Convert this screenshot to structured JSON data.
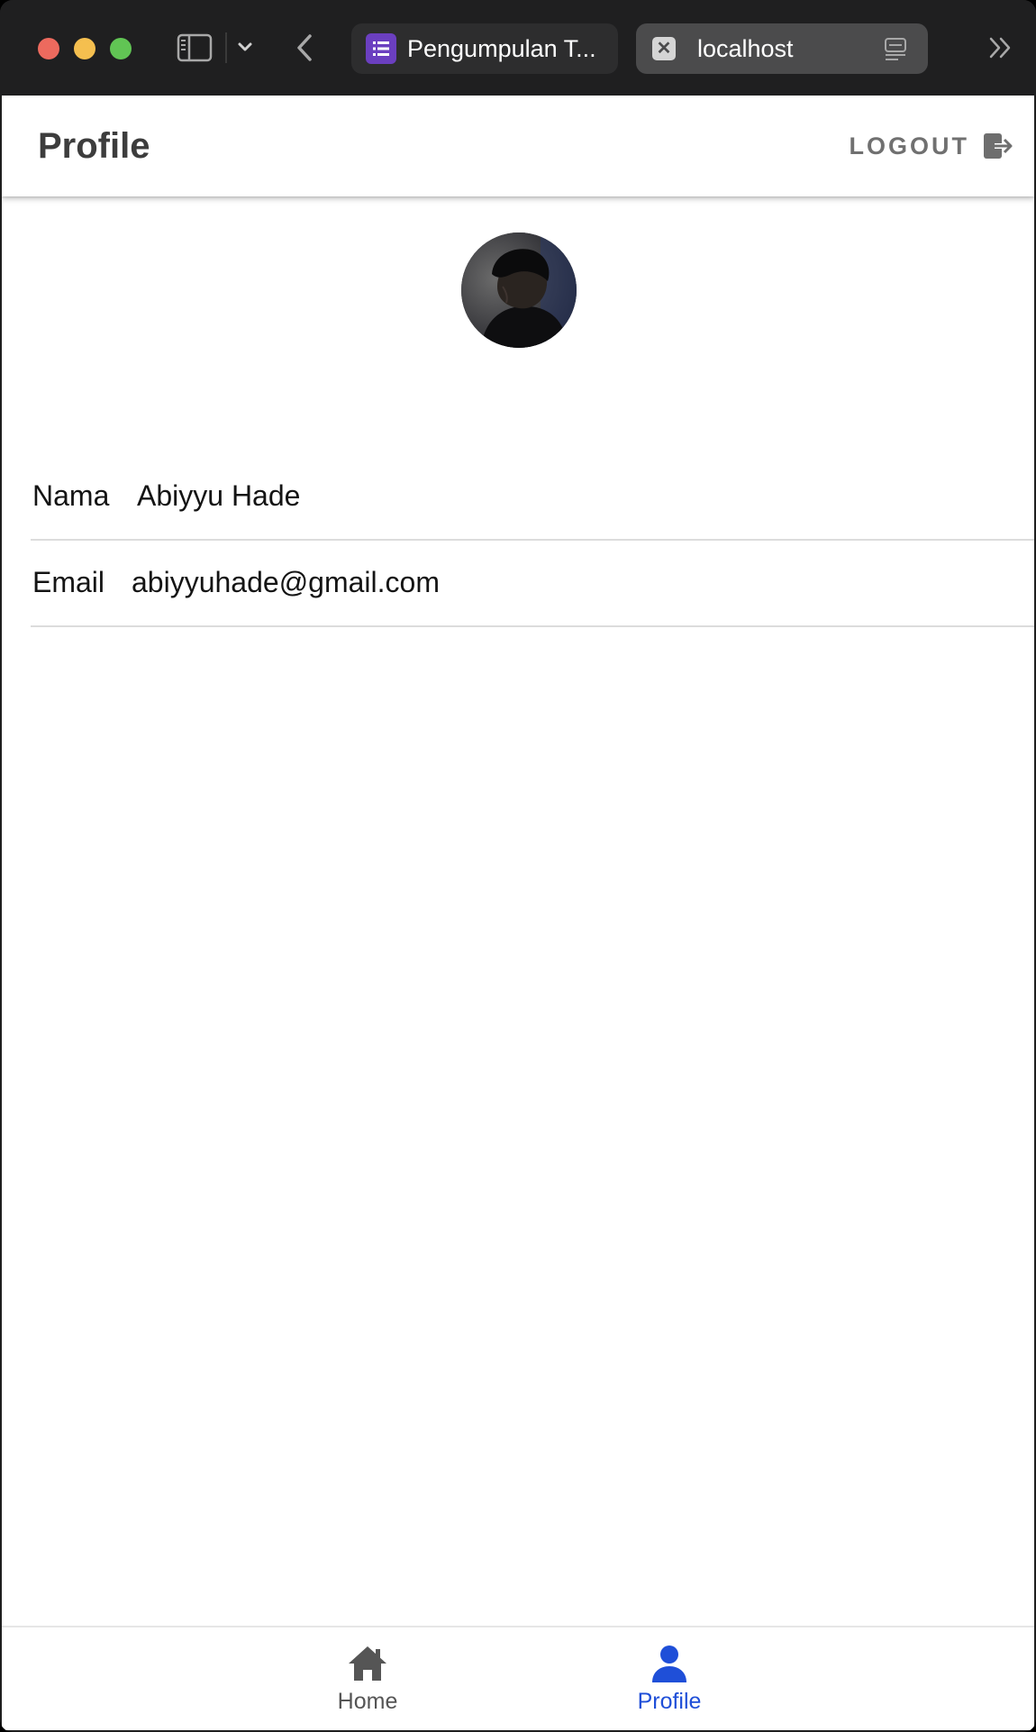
{
  "browser": {
    "tabs": [
      {
        "title": "Pengumpulan T...",
        "favicon": "forms-list-icon",
        "active": false
      },
      {
        "title": "localhost",
        "favicon": "close-x-icon",
        "active": true
      }
    ]
  },
  "header": {
    "title": "Profile",
    "logout_label": "LOGOUT"
  },
  "profile": {
    "fields": [
      {
        "label": "Nama",
        "value": "Abiyyu Hade"
      },
      {
        "label": "Email",
        "value": "abiyyuhade@gmail.com"
      }
    ]
  },
  "bottom_nav": {
    "items": [
      {
        "label": "Home",
        "icon": "home-icon",
        "active": false
      },
      {
        "label": "Profile",
        "icon": "person-icon",
        "active": true
      }
    ]
  },
  "colors": {
    "accent": "#1f4fd8",
    "inactive": "#555555",
    "titlebar": "#1f1f20"
  }
}
